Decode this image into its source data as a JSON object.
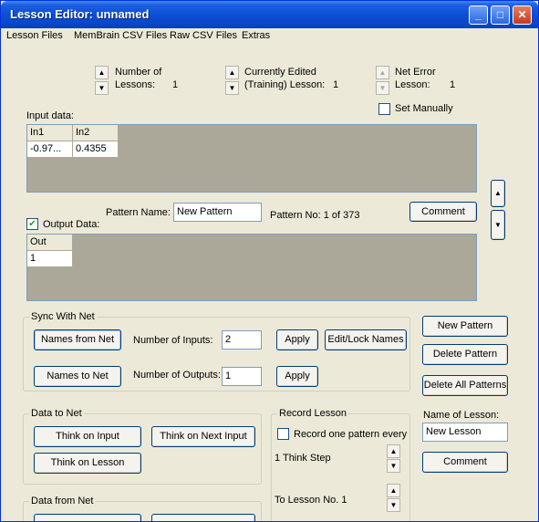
{
  "window": {
    "title": "Lesson Editor: unnamed"
  },
  "menu": [
    "Lesson Files",
    "MemBrain CSV Files",
    "Raw CSV Files",
    "Extras"
  ],
  "lessons": {
    "number_label_1": "Number of",
    "number_label_2": "Lessons:",
    "number_value": "1",
    "edited_label_1": "Currently Edited",
    "edited_label_2": "(Training) Lesson:",
    "edited_value": "1",
    "neterr_label_1": "Net Error",
    "neterr_label_2": "Lesson:",
    "neterr_value": "1",
    "set_manually": "Set Manually"
  },
  "input": {
    "label": "Input data:",
    "headers": [
      "In1",
      "In2"
    ],
    "values": [
      "-0.97...",
      "0.4355"
    ]
  },
  "pattern": {
    "name_label": "Pattern Name:",
    "name_value": "New Pattern",
    "number_text": "Pattern No: 1 of 373",
    "comment_btn": "Comment",
    "up_arrow": "▲",
    "down_arrow": "▼"
  },
  "output": {
    "label": "Output Data:",
    "headers": [
      "Out"
    ],
    "values": [
      "1"
    ]
  },
  "sync": {
    "title": "Sync With Net",
    "names_from_net": "Names from Net",
    "names_to_net": "Names to Net",
    "inputs_label": "Number of Inputs:",
    "inputs_value": "2",
    "outputs_label": "Number of Outputs:",
    "outputs_value": "1",
    "apply1": "Apply",
    "apply2": "Apply",
    "edit_lock": "Edit/Lock Names"
  },
  "pattern_buttons": {
    "new": "New Pattern",
    "delete": "Delete Pattern",
    "delete_all": "Delete All Patterns"
  },
  "data_to_net": {
    "title": "Data to Net",
    "think_input": "Think on Input",
    "think_next": "Think on Next Input",
    "think_lesson": "Think on Lesson"
  },
  "record": {
    "title": "Record Lesson",
    "checkbox": "Record one pattern every",
    "step": "1 Think Step",
    "to_lesson": "To Lesson No. 1"
  },
  "lesson_name": {
    "label": "Name of Lesson:",
    "value": "New Lesson",
    "comment": "Comment"
  },
  "data_from_net": {
    "title": "Data from Net"
  },
  "icons": {
    "minimize": "minimize-icon",
    "maximize": "maximize-icon",
    "close": "close-icon",
    "spin_up": "spin-up-icon",
    "spin_down": "spin-down-icon",
    "checkmark": "checkmark-icon"
  }
}
